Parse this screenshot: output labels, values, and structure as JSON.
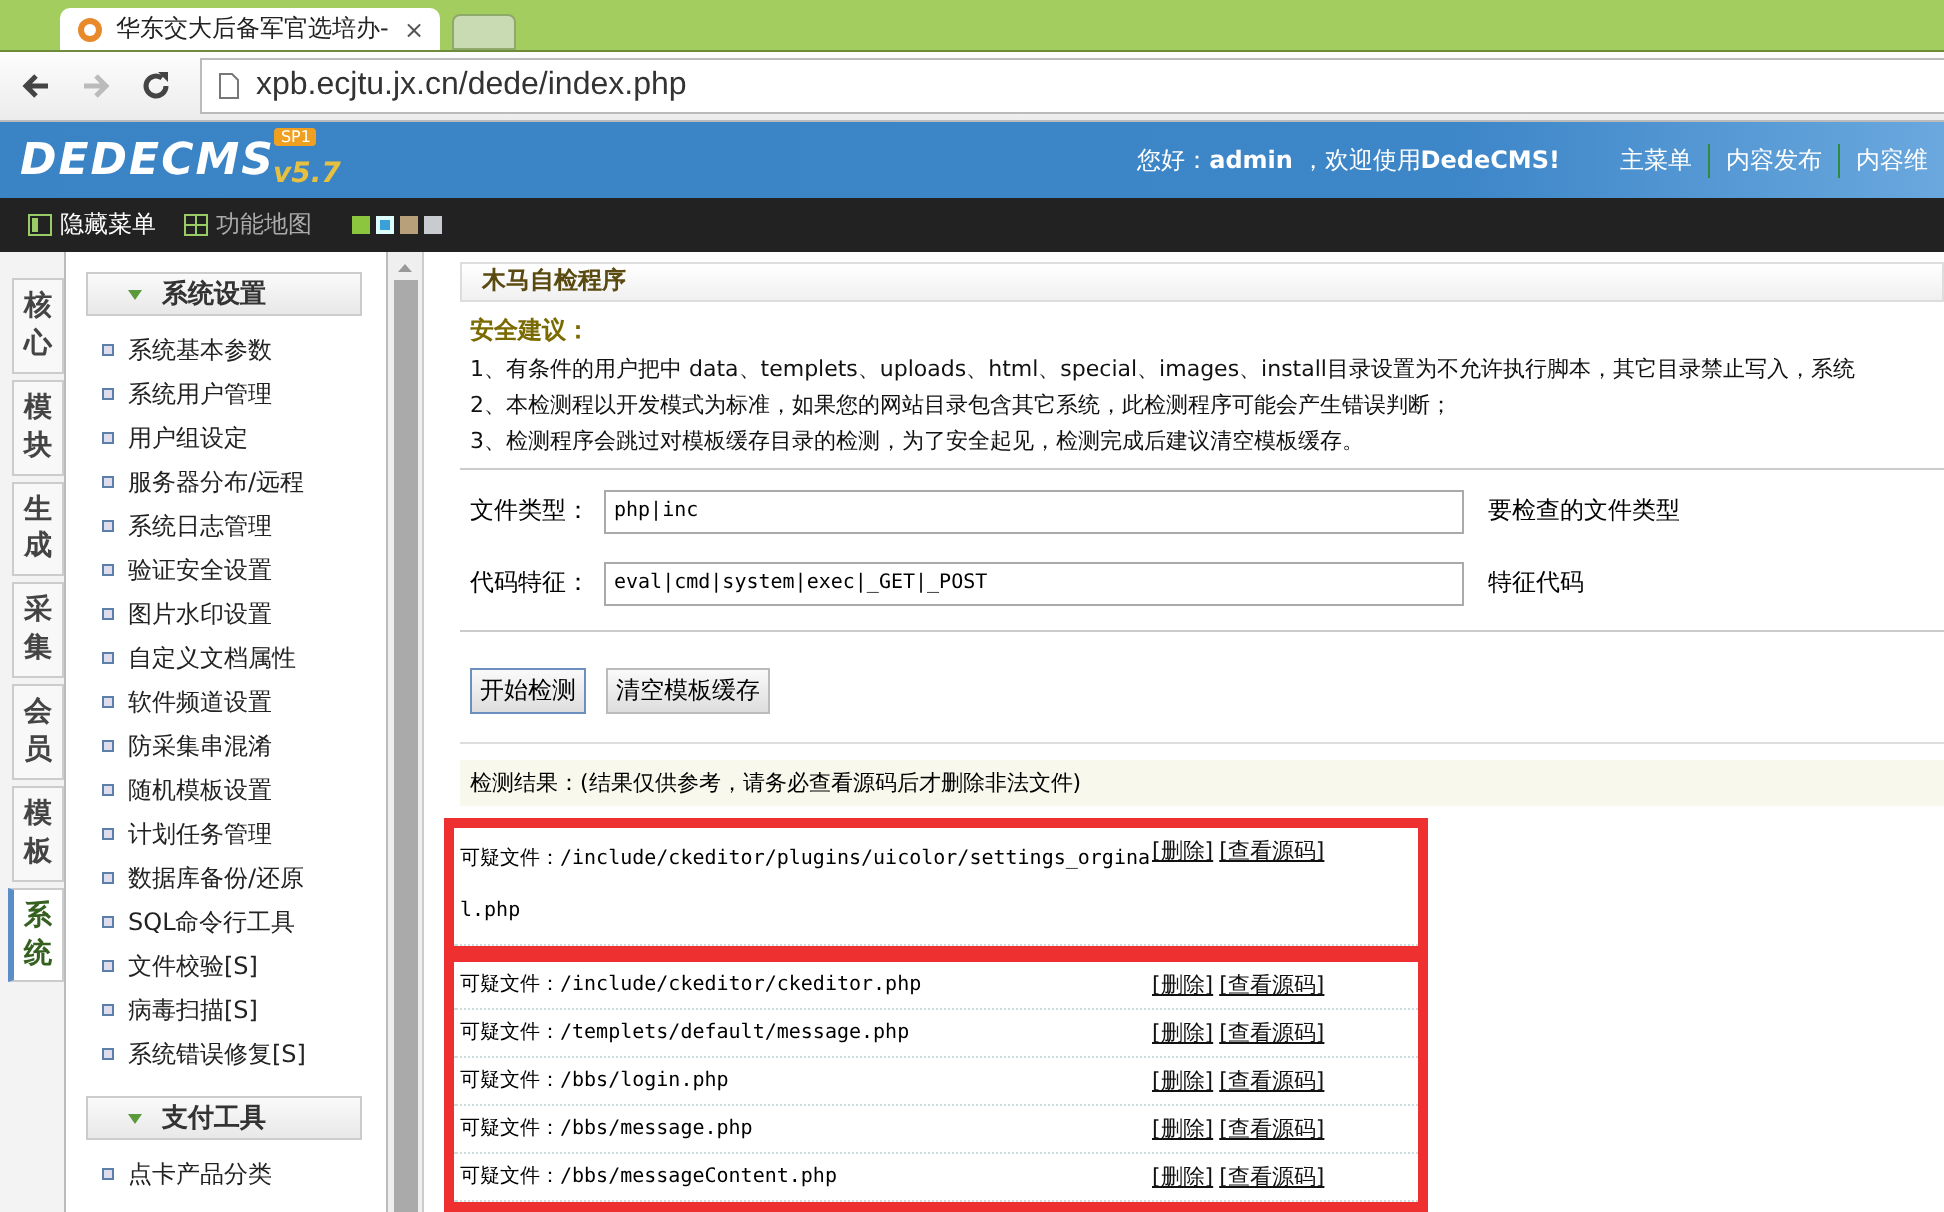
{
  "browser": {
    "tab_title": "华东交大后备军官选培办-",
    "tab_close": "×",
    "url": "xpb.ecjtu.jx.cn/dede/index.php"
  },
  "header": {
    "logo": "DEDECMS",
    "badge": "SP1",
    "version": "v5.7",
    "greeting": "您好：**admin** ，欢迎使用**DedeCMS!**",
    "nav": [
      "主菜单",
      "内容发布",
      "内容维"
    ]
  },
  "toolbar": {
    "items": [
      "隐藏菜单",
      "功能地图"
    ],
    "skins": [
      {
        "color": "#8cc63f",
        "selected": false
      },
      {
        "color": "#3aa0d8",
        "selected": true
      },
      {
        "color": "#b8a07a",
        "selected": false
      },
      {
        "color": "#c8ccd0",
        "selected": false
      }
    ]
  },
  "side_tabs": [
    {
      "label": "核心",
      "selected": false
    },
    {
      "label": "模块",
      "selected": false
    },
    {
      "label": "生成",
      "selected": false
    },
    {
      "label": "采集",
      "selected": false
    },
    {
      "label": "会员",
      "selected": false
    },
    {
      "label": "模板",
      "selected": false
    },
    {
      "label": "系统",
      "selected": true
    }
  ],
  "menu": [
    {
      "title": "系统设置",
      "expanded": true,
      "items": [
        "系统基本参数",
        "系统用户管理",
        "用户组设定",
        "服务器分布/远程",
        "系统日志管理",
        "验证安全设置",
        "图片水印设置",
        "自定义文档属性",
        "软件频道设置",
        "防采集串混淆",
        "随机模板设置",
        "计划任务管理",
        "数据库备份/还原",
        "SQL命令行工具",
        "文件校验[S]",
        "病毒扫描[S]",
        "系统错误修复[S]"
      ]
    },
    {
      "title": "支付工具",
      "expanded": true,
      "items": [
        "点卡产品分类"
      ]
    }
  ],
  "panel": {
    "title": "木马自检程序",
    "advice_title": "安全建议：",
    "advice": [
      "1、有条件的用户把中 data、templets、uploads、html、special、images、install目录设置为不允许执行脚本，其它目录禁止写入，系统",
      "2、本检测程以开发模式为标准，如果您的网站目录包含其它系统，此检测程序可能会产生错误判断；",
      "3、检测程序会跳过对模板缓存目录的检测，为了安全起见，检测完成后建议清空模板缓存。"
    ],
    "fields": [
      {
        "label": "文件类型：",
        "value": "php|inc",
        "hint": "要检查的文件类型"
      },
      {
        "label": "代码特征：",
        "value": "eval|cmd|system|exec|_GET|_POST",
        "hint": "特征代码"
      }
    ],
    "buttons": [
      "开始检测",
      "清空模板缓存"
    ],
    "result_title": "检测结果：(结果仅供参考，请务必查看源码后才删除非法文件)",
    "highlight_groups": [
      [
        {
          "file": "可疑文件：/include/ckeditor/plugins/uicolor/settings_orginal.php",
          "delete": "[删除]",
          "view": "[查看源码]"
        }
      ],
      [
        {
          "file": "可疑文件：/include/ckeditor/ckeditor.php",
          "delete": "[删除]",
          "view": "[查看源码]"
        },
        {
          "file": "可疑文件：/templets/default/message.php",
          "delete": "[删除]",
          "view": "[查看源码]"
        },
        {
          "file": "可疑文件：/bbs/login.php",
          "delete": "[删除]",
          "view": "[查看源码]"
        },
        {
          "file": "可疑文件：/bbs/message.php",
          "delete": "[删除]",
          "view": "[查看源码]"
        },
        {
          "file": "可疑文件：/bbs/messageContent.php",
          "delete": "[删除]",
          "view": "[查看源码]"
        }
      ]
    ]
  }
}
